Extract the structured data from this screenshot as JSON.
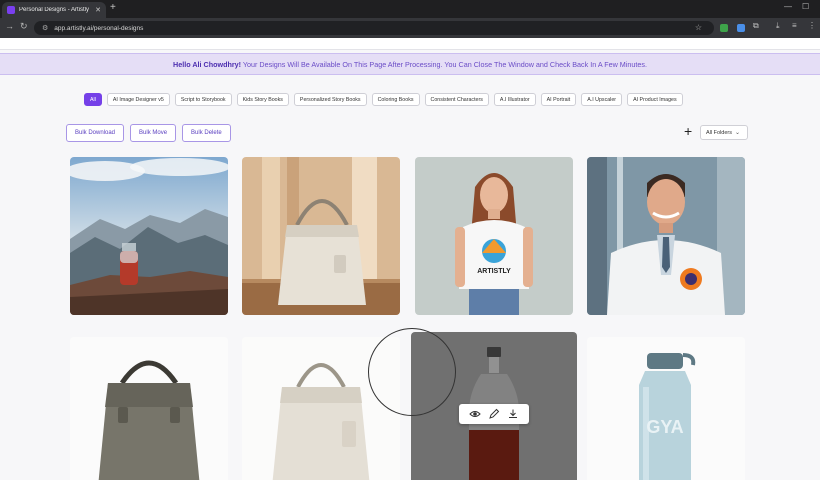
{
  "browser": {
    "tab_title": "Personal Designs - Artistly",
    "url": "app.artistly.ai/personal-designs"
  },
  "banner": {
    "greeting": "Hello Ali Chowdhry!",
    "message": " Your Designs Will Be Available On This Page After Processing. You Can Close The Window and Check Back In A Few Minutes."
  },
  "filters": [
    "All",
    "AI Image Designer v5",
    "Script to Storybook",
    "Kids Story Books",
    "Personalized Story Books",
    "Coloring Books",
    "Consistent Characters",
    "A.I Illustrator",
    "AI Portrait",
    "A.I Upscaler",
    "AI Product Images"
  ],
  "actions": {
    "bulk_download": "Bulk Download",
    "bulk_move": "Bulk Move",
    "bulk_delete": "Bulk Delete"
  },
  "folder_select": "All Folders",
  "images": {
    "shirt_logo": "ARTISTLY",
    "bottle_logo": "GYA"
  },
  "colors": {
    "accent": "#7540e8",
    "banner_bg": "#e5def6"
  }
}
